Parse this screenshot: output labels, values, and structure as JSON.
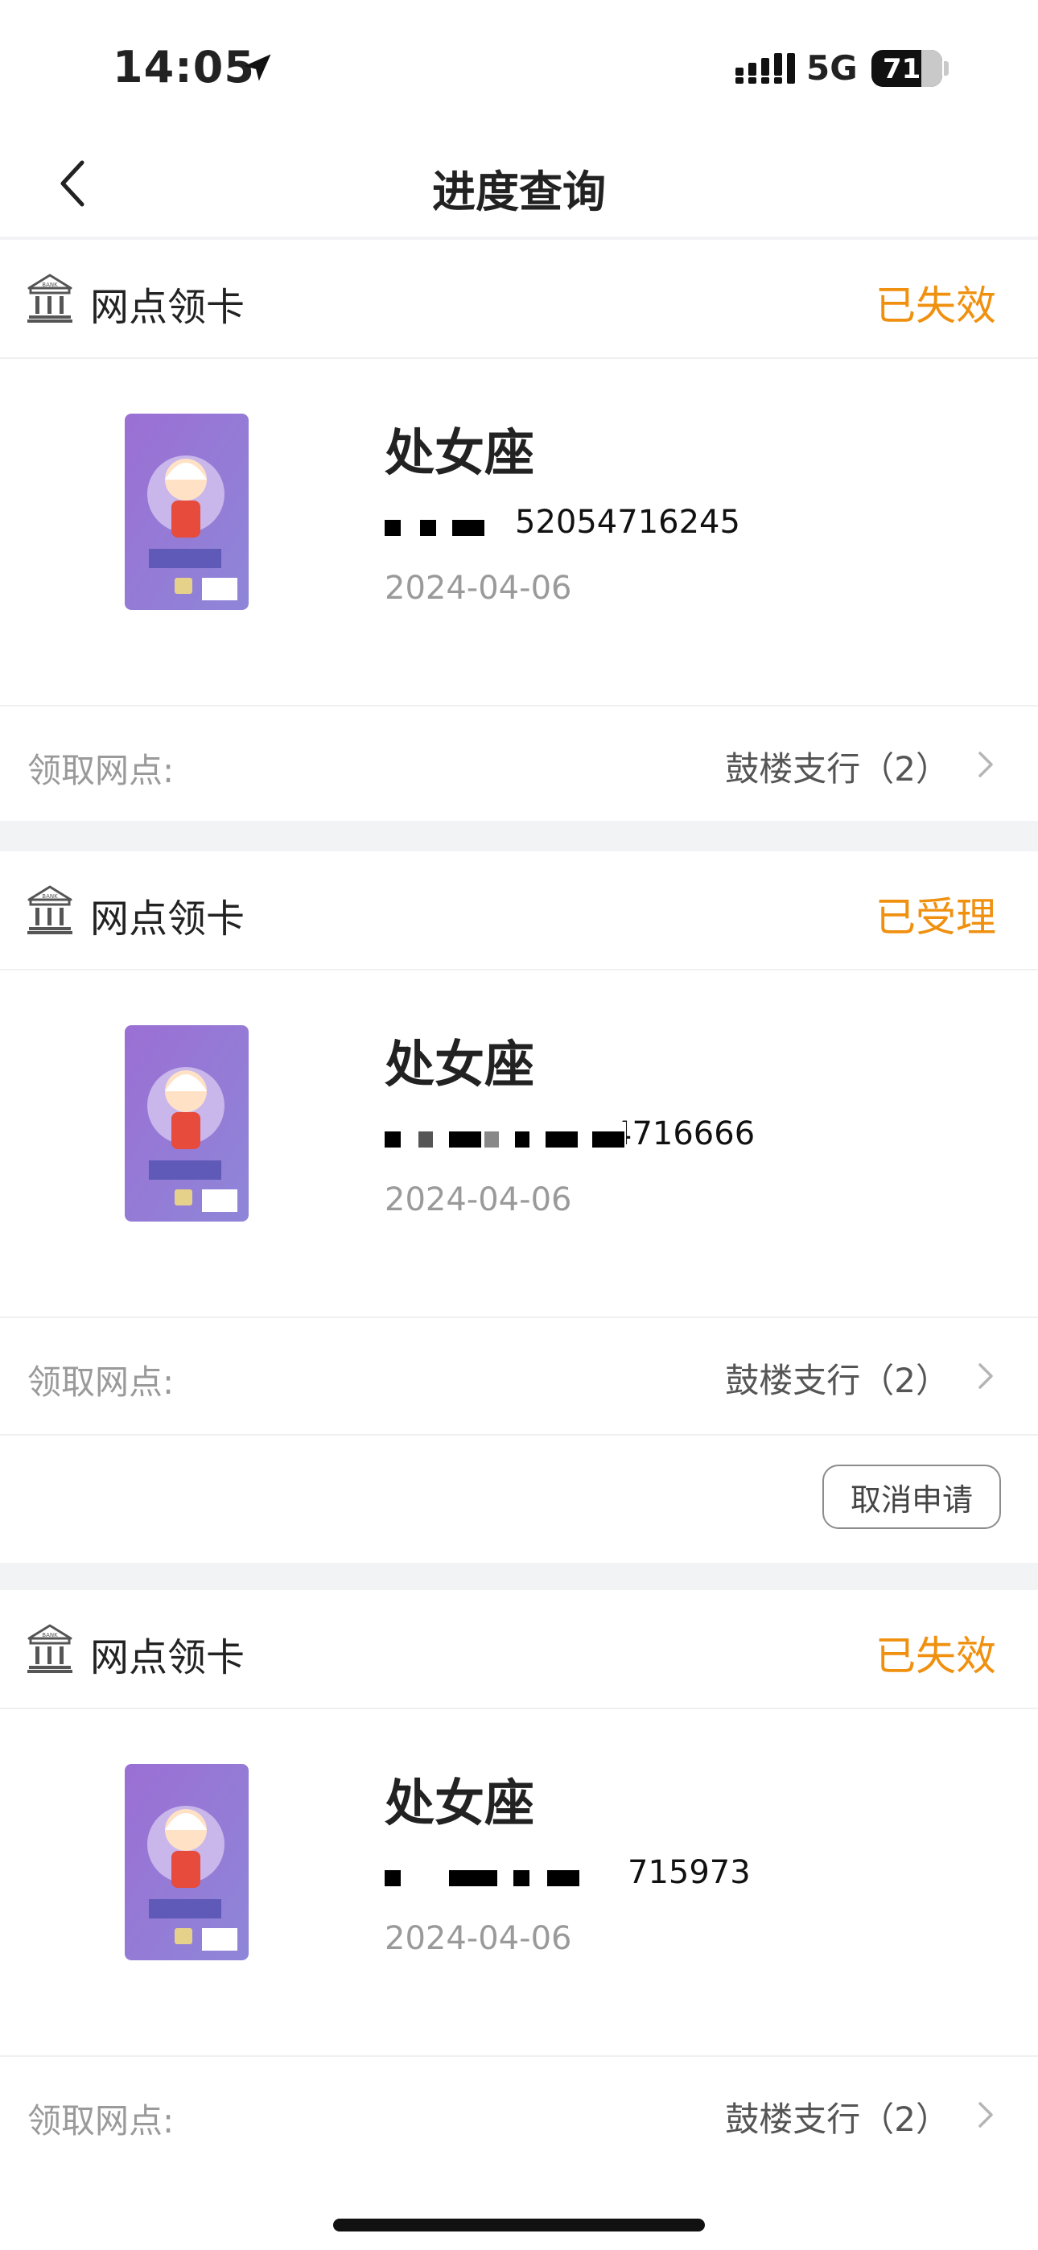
{
  "status_bar": {
    "time": "14:05",
    "network": "5G",
    "battery": "71",
    "icons": [
      "location-arrow-icon",
      "signal-bars-icon",
      "battery-icon"
    ]
  },
  "nav": {
    "title": "进度查询",
    "back_icon": "chevron-left-icon"
  },
  "applications": [
    {
      "type_label": "网点领卡",
      "status": "已失效",
      "card_name": "处女座",
      "card_number_visible": "52054716245",
      "date": "2024-04-06",
      "pickup_label": "领取网点:",
      "pickup_branch": "鼓楼支行（2）"
    },
    {
      "type_label": "网点领卡",
      "status": "已受理",
      "card_name": "处女座",
      "card_number_visible": "4716666",
      "date": "2024-04-06",
      "pickup_label": "领取网点:",
      "pickup_branch": "鼓楼支行（2）",
      "action_label": "取消申请"
    },
    {
      "type_label": "网点领卡",
      "status": "已失效",
      "card_name": "处女座",
      "card_number_visible": "715973",
      "date": "2024-04-06",
      "pickup_label": "领取网点:",
      "pickup_branch": "鼓楼支行（2）"
    }
  ],
  "colors": {
    "status_orange": "#f0900f",
    "section_gap": "#f2f3f5",
    "card_purple": "#9a7fd0"
  }
}
